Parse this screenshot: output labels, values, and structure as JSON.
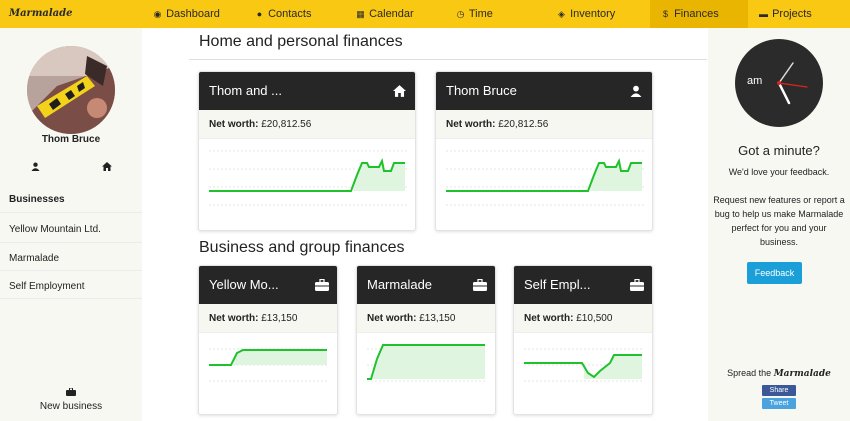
{
  "app": {
    "logo": "Marmalade"
  },
  "nav": {
    "items": [
      {
        "label": "Dashboard",
        "icon": "dashboard-icon",
        "glyph": "◉"
      },
      {
        "label": "Contacts",
        "icon": "user-icon",
        "glyph": "●"
      },
      {
        "label": "Calendar",
        "icon": "calendar-icon",
        "glyph": "▦"
      },
      {
        "label": "Time",
        "icon": "clock-icon",
        "glyph": "◷"
      },
      {
        "label": "Inventory",
        "icon": "cube-icon",
        "glyph": "◈"
      },
      {
        "label": "Finances",
        "icon": "dollar-icon",
        "glyph": "$"
      },
      {
        "label": "Projects",
        "icon": "folder-icon",
        "glyph": "▬"
      }
    ],
    "active": "Finances"
  },
  "sidebar": {
    "user_name": "Thom Bruce",
    "businesses_heading": "Businesses",
    "businesses": [
      "Yellow Mountain Ltd.",
      "Marmalade",
      "Self Employment"
    ],
    "new_business_label": "New business"
  },
  "main": {
    "personal_heading": "Home and personal finances",
    "business_heading": "Business and group finances",
    "net_worth_label": "Net worth:",
    "personal_cards": [
      {
        "title": "Thom and ...",
        "icon": "home-icon",
        "net_worth": "£20,812.56"
      },
      {
        "title": "Thom Bruce",
        "icon": "user-icon",
        "net_worth": "£20,812.56"
      }
    ],
    "business_cards": [
      {
        "title": "Yellow Mo...",
        "icon": "briefcase-icon",
        "net_worth": "£13,150"
      },
      {
        "title": "Marmalade",
        "icon": "briefcase-icon",
        "net_worth": "£13,150"
      },
      {
        "title": "Self Empl...",
        "icon": "briefcase-icon",
        "net_worth": "£10,500"
      }
    ]
  },
  "right": {
    "clock_label": "am",
    "feedback_title": "Got a minute?",
    "feedback_line1": "We'd love your feedback.",
    "feedback_text": "Request new features or report a bug to help us make Marmalade perfect for you and your business.",
    "feedback_button": "Feedback",
    "spread_prefix": "Spread the",
    "spread_brand": "Marmalade",
    "share_label": "Share",
    "tweet_label": "Tweet"
  },
  "colors": {
    "accent": "#f9c813",
    "card_header": "#262626",
    "chart_line": "#1fc22c",
    "feedback_button": "#1a9fd8",
    "facebook": "#3b5998",
    "twitter": "#4aa3df"
  }
}
